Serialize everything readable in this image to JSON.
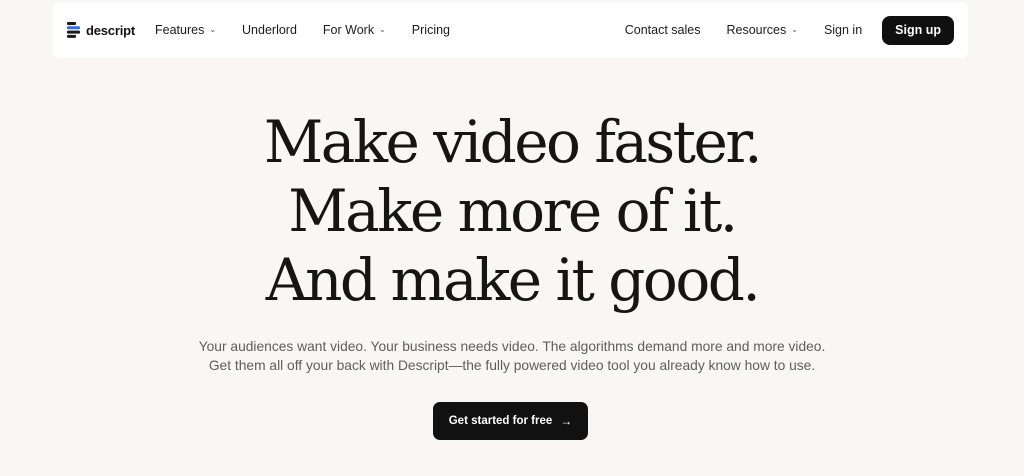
{
  "brand": {
    "name": "descript"
  },
  "nav": {
    "left": [
      {
        "label": "Features",
        "dropdown": true
      },
      {
        "label": "Underlord",
        "dropdown": false
      },
      {
        "label": "For Work",
        "dropdown": true
      },
      {
        "label": "Pricing",
        "dropdown": false
      }
    ],
    "right": [
      {
        "label": "Contact sales",
        "dropdown": false
      },
      {
        "label": "Resources",
        "dropdown": true
      },
      {
        "label": "Sign in",
        "dropdown": false
      }
    ],
    "signup_label": "Sign up",
    "chevron_icon": "chevron-down-icon"
  },
  "hero": {
    "line1": "Make video faster.",
    "line2": "Make more of it.",
    "line3": "And make it good.",
    "sub1": "Your audiences want video. Your business needs video. The algorithms demand more and more video.",
    "sub2": "Get them all off your back with Descript—the fully powered video tool you already know how to use.",
    "cta_label": "Get started for free",
    "cta_icon": "arrow-right-icon"
  },
  "colors": {
    "background": "#f8f7f6",
    "nav_background": "#ffffff",
    "button_dark": "#111111",
    "text": "#141414",
    "subtext": "#5e5e5e",
    "logo_blue": "#2f6df6"
  }
}
